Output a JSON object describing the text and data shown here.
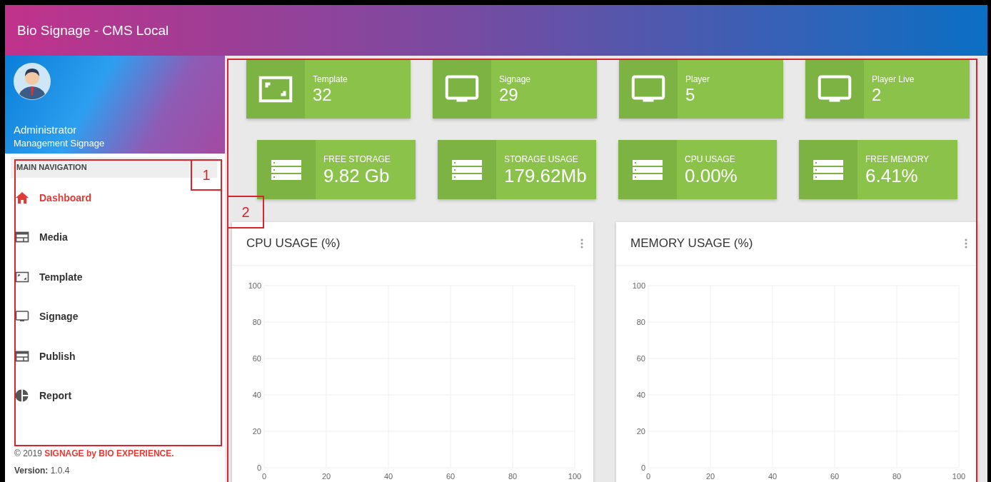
{
  "window": {
    "title": "Bio Signage - CMS Local"
  },
  "profile": {
    "name": "Administrator",
    "role": "Management Signage"
  },
  "sidebar": {
    "heading": "MAIN NAVIGATION",
    "items": [
      {
        "label": "Dashboard",
        "kind": "home",
        "selected": true
      },
      {
        "label": "Media",
        "kind": "window",
        "selected": false
      },
      {
        "label": "Template",
        "kind": "template",
        "selected": false
      },
      {
        "label": "Signage",
        "kind": "monitor",
        "selected": false
      },
      {
        "label": "Publish",
        "kind": "window",
        "selected": false
      },
      {
        "label": "Report",
        "kind": "pie",
        "selected": false
      }
    ]
  },
  "footer": {
    "copyright": "© 2019",
    "brand": "SIGNAGE by BIO EXPERIENCE.",
    "version_label": "Version:",
    "version": "1.0.4"
  },
  "stats_top": [
    {
      "label": "Template",
      "value": "32",
      "kind": "template"
    },
    {
      "label": "Signage",
      "value": "29",
      "kind": "monitor"
    },
    {
      "label": "Player",
      "value": "5",
      "kind": "monitor"
    },
    {
      "label": "Player Live",
      "value": "2",
      "kind": "monitor"
    }
  ],
  "stats_bottom": [
    {
      "label": "FREE STORAGE",
      "value": "9.82 Gb"
    },
    {
      "label": "STORAGE USAGE",
      "value": "179.62Mb"
    },
    {
      "label": "CPU USAGE",
      "value": "0.00%"
    },
    {
      "label": "FREE MEMORY",
      "value": "6.41%"
    }
  ],
  "charts": [
    {
      "title": "CPU USAGE (%)",
      "chart_data": {
        "type": "line",
        "grid": true,
        "xlim": [
          0,
          100
        ],
        "ylim": [
          0,
          100
        ],
        "xticks": [
          0,
          20,
          40,
          60,
          80,
          100
        ],
        "yticks": [
          0,
          20,
          40,
          60,
          80,
          100
        ]
      }
    },
    {
      "title": "MEMORY USAGE (%)",
      "chart_data": {
        "type": "line",
        "grid": true,
        "xlim": [
          0,
          100
        ],
        "ylim": [
          0,
          100
        ],
        "xticks": [
          0,
          20,
          40,
          60,
          80,
          100
        ],
        "yticks": [
          0,
          20,
          40,
          60,
          80,
          100
        ]
      }
    }
  ],
  "callouts": [
    {
      "label": "1"
    },
    {
      "label": "2"
    }
  ]
}
